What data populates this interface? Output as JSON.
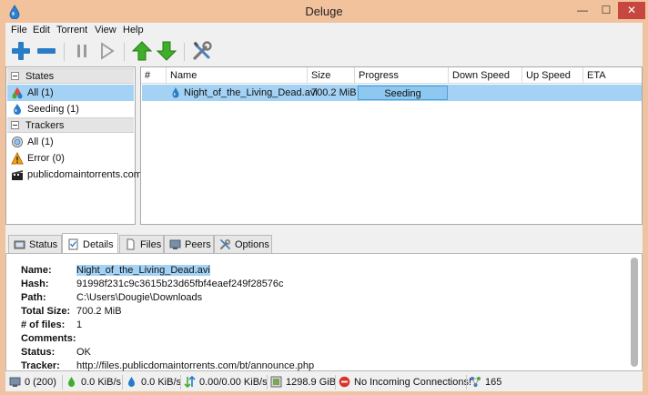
{
  "window": {
    "title": "Deluge"
  },
  "titlebar": {
    "minimize": "—",
    "maximize": "☐",
    "close": "✕"
  },
  "menu": [
    "File",
    "Edit",
    "Torrent",
    "View",
    "Help"
  ],
  "sidebar": {
    "states_header": "States",
    "states": [
      {
        "label": "All (1)",
        "icon": "all-torrents-icon",
        "selected": true
      },
      {
        "label": "Seeding (1)",
        "icon": "seeding-icon",
        "selected": false
      }
    ],
    "trackers_header": "Trackers",
    "trackers": [
      {
        "label": "All (1)",
        "icon": "trackers-all-icon"
      },
      {
        "label": "Error (0)",
        "icon": "error-icon"
      },
      {
        "label": "publicdomaintorrents.com",
        "icon": "tracker-favicon-icon"
      }
    ]
  },
  "torrent_list": {
    "columns": [
      "#",
      "Name",
      "Size",
      "Progress",
      "Down Speed",
      "Up Speed",
      "ETA"
    ],
    "rows": [
      {
        "num": "",
        "name": "Night_of_the_Living_Dead.avi",
        "size": "700.2 MiB",
        "progress_label": "Seeding",
        "progress": 1.0,
        "down_speed": "",
        "up_speed": "",
        "eta": ""
      }
    ]
  },
  "tabs": [
    "Status",
    "Details",
    "Files",
    "Peers",
    "Options"
  ],
  "active_tab": "Details",
  "details": {
    "labels": [
      "Name:",
      "Hash:",
      "Path:",
      "Total Size:",
      "# of files:",
      "Comments:",
      "Status:",
      "Tracker:"
    ],
    "values": [
      "Night_of_the_Living_Dead.avi",
      "91998f231c9c3615b23d65fbf4eaef249f28576c",
      "C:\\Users\\Dougie\\Downloads",
      "700.2 MiB",
      "1",
      "",
      "OK",
      "http://files.publicdomaintorrents.com/bt/announce.php"
    ]
  },
  "statusbar": {
    "connections": "0 (200)",
    "download_speed": "0.0 KiB/s",
    "upload_speed": "0.0 KiB/s",
    "protocol_traffic": "0.00/0.00 KiB/s",
    "free_space": "1298.9 GiB",
    "incoming": "No Incoming Connections!",
    "dht_nodes": "165"
  },
  "colors": {
    "selection": "#a3d2f4",
    "progress_fill": "#8ec7f0",
    "close_button": "#c7463f",
    "window_frame": "#f0c3a0"
  }
}
